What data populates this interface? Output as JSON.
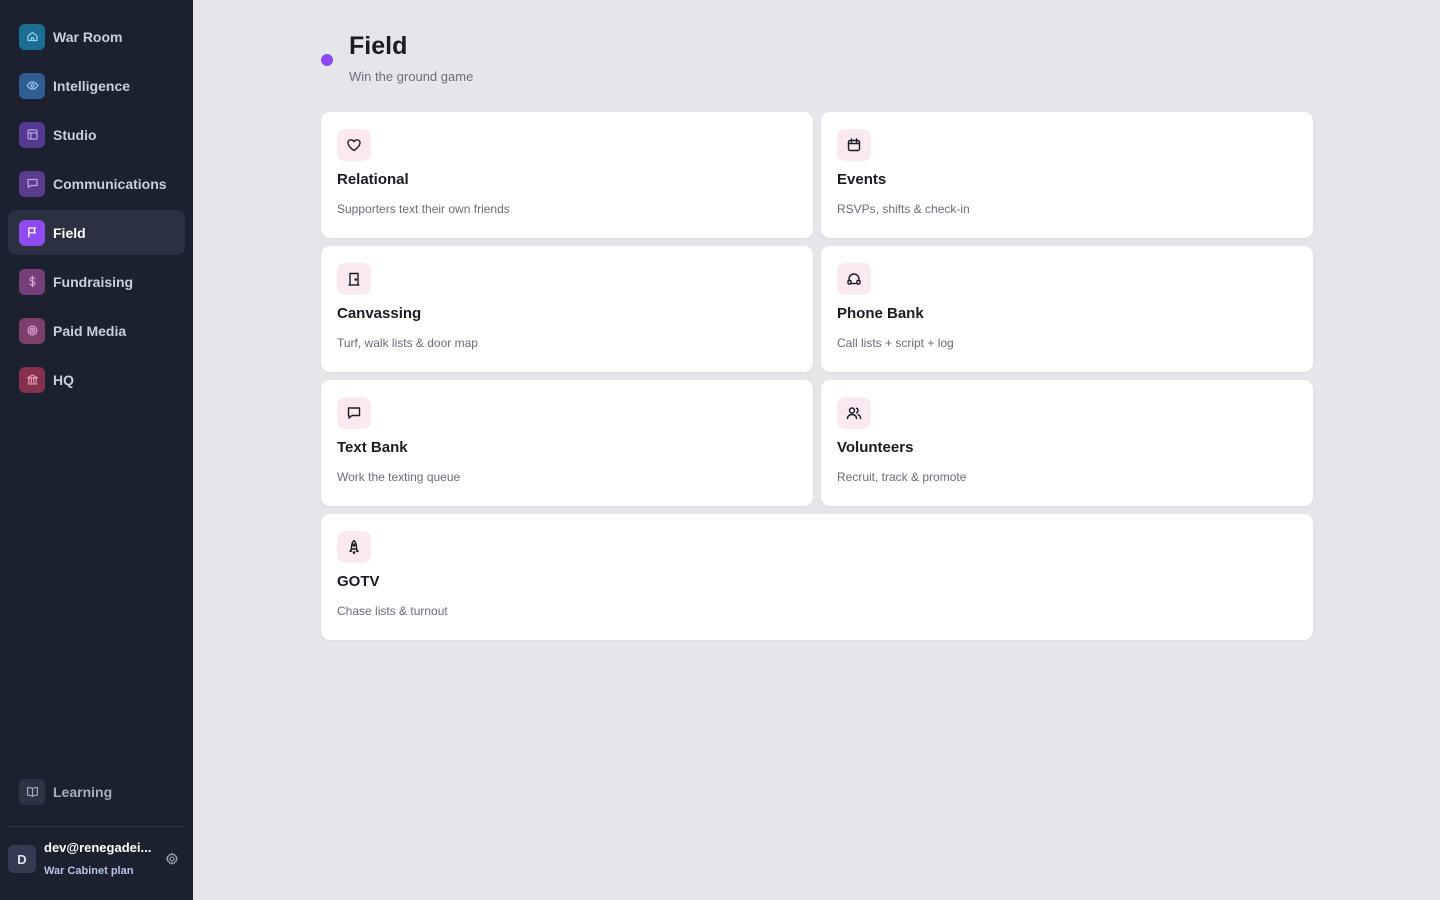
{
  "sidebar": {
    "items": [
      {
        "label": "War Room",
        "icon": "home-icon",
        "color": "#1c6f93"
      },
      {
        "label": "Intelligence",
        "icon": "eye-icon",
        "color": "#2e5e92"
      },
      {
        "label": "Studio",
        "icon": "layout-icon",
        "color": "#563a92"
      },
      {
        "label": "Communications",
        "icon": "message-icon",
        "color": "#5c3a8e"
      },
      {
        "label": "Field",
        "icon": "flag-icon",
        "color": "#8d4af0",
        "active": true
      },
      {
        "label": "Fundraising",
        "icon": "dollar-icon",
        "color": "#763f7a"
      },
      {
        "label": "Paid Media",
        "icon": "target-icon",
        "color": "#7e3f6c"
      },
      {
        "label": "HQ",
        "icon": "building-icon",
        "color": "#86304f"
      }
    ],
    "learning": {
      "label": "Learning",
      "icon": "book-icon",
      "color": "#2c3344"
    },
    "user": {
      "initial": "D",
      "email": "dev@renegadei...",
      "plan": "War Cabinet plan"
    }
  },
  "header": {
    "title": "Field",
    "subtitle": "Win the ground game",
    "accent": "#8b48f0"
  },
  "cards": [
    {
      "title": "Relational",
      "desc": "Supporters text their own friends",
      "icon": "heart-icon"
    },
    {
      "title": "Events",
      "desc": "RSVPs, shifts & check-in",
      "icon": "calendar-icon"
    },
    {
      "title": "Canvassing",
      "desc": "Turf, walk lists & door map",
      "icon": "door-icon"
    },
    {
      "title": "Phone Bank",
      "desc": "Call lists + script + log",
      "icon": "headset-icon"
    },
    {
      "title": "Text Bank",
      "desc": "Work the texting queue",
      "icon": "chat-icon"
    },
    {
      "title": "Volunteers",
      "desc": "Recruit, track & promote",
      "icon": "users-icon"
    },
    {
      "title": "GOTV",
      "desc": "Chase lists & turnout",
      "icon": "rocket-icon"
    }
  ]
}
